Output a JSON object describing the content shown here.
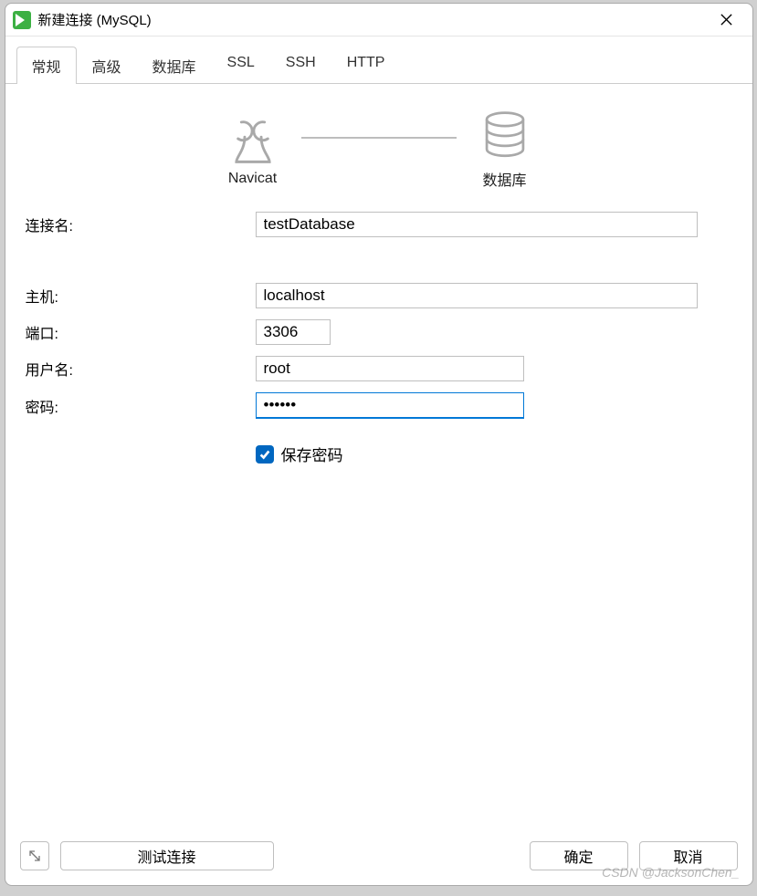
{
  "window": {
    "title": "新建连接 (MySQL)"
  },
  "tabs": [
    {
      "label": "常规",
      "active": true
    },
    {
      "label": "高级",
      "active": false
    },
    {
      "label": "数据库",
      "active": false
    },
    {
      "label": "SSL",
      "active": false
    },
    {
      "label": "SSH",
      "active": false
    },
    {
      "label": "HTTP",
      "active": false
    }
  ],
  "hero": {
    "left_label": "Navicat",
    "right_label": "数据库"
  },
  "form": {
    "conn_name_label": "连接名:",
    "conn_name_value": "testDatabase",
    "host_label": "主机:",
    "host_value": "localhost",
    "port_label": "端口:",
    "port_value": "3306",
    "user_label": "用户名:",
    "user_value": "root",
    "pass_label": "密码:",
    "pass_value": "••••••",
    "save_pass_label": "保存密码",
    "save_pass_checked": true
  },
  "footer": {
    "test_label": "测试连接",
    "ok_label": "确定",
    "cancel_label": "取消"
  },
  "watermark": "CSDN @JacksonChen_"
}
